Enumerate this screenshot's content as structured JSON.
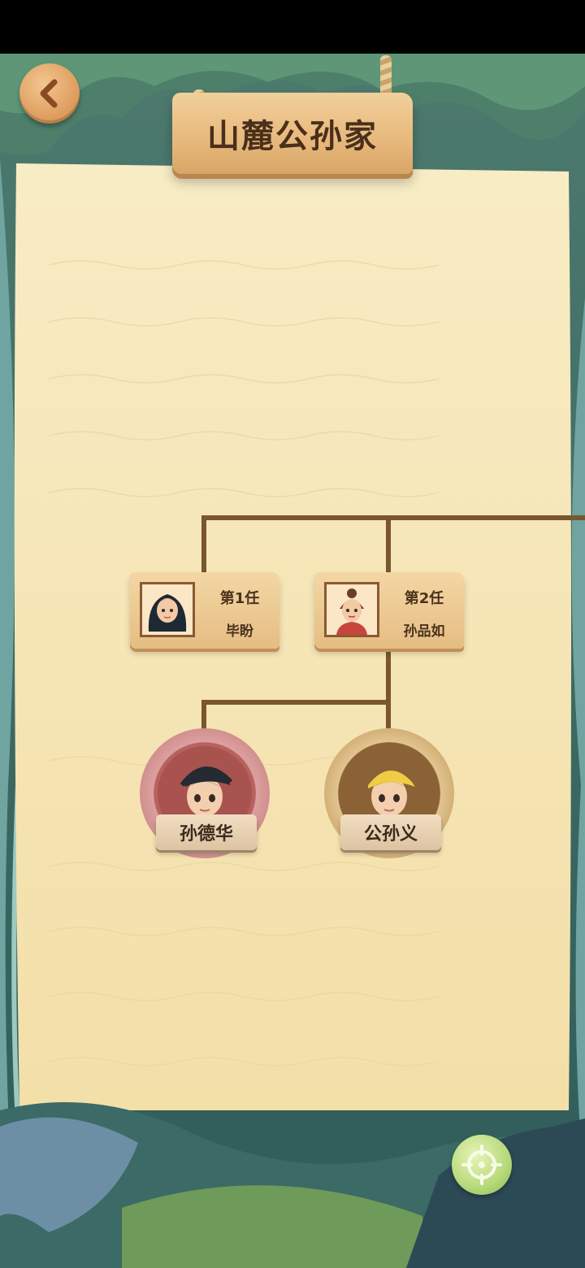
{
  "header": {
    "title": "山麓公孙家"
  },
  "icons": {
    "back": "back-chevron-icon",
    "locate": "crosshair-icon"
  },
  "colors": {
    "paper": "#f6e6b4",
    "tree_line": "#7a5530",
    "plank": "#e7b87c",
    "child_ring_pink": "#c98582",
    "child_ring_tan": "#c9a468"
  },
  "family_tree": {
    "wives": [
      {
        "rank": "第1任",
        "name": "毕盼"
      },
      {
        "rank": "第2任",
        "name": "孙品如"
      }
    ],
    "children": [
      {
        "name": "孙德华"
      },
      {
        "name": "公孙义"
      }
    ]
  }
}
